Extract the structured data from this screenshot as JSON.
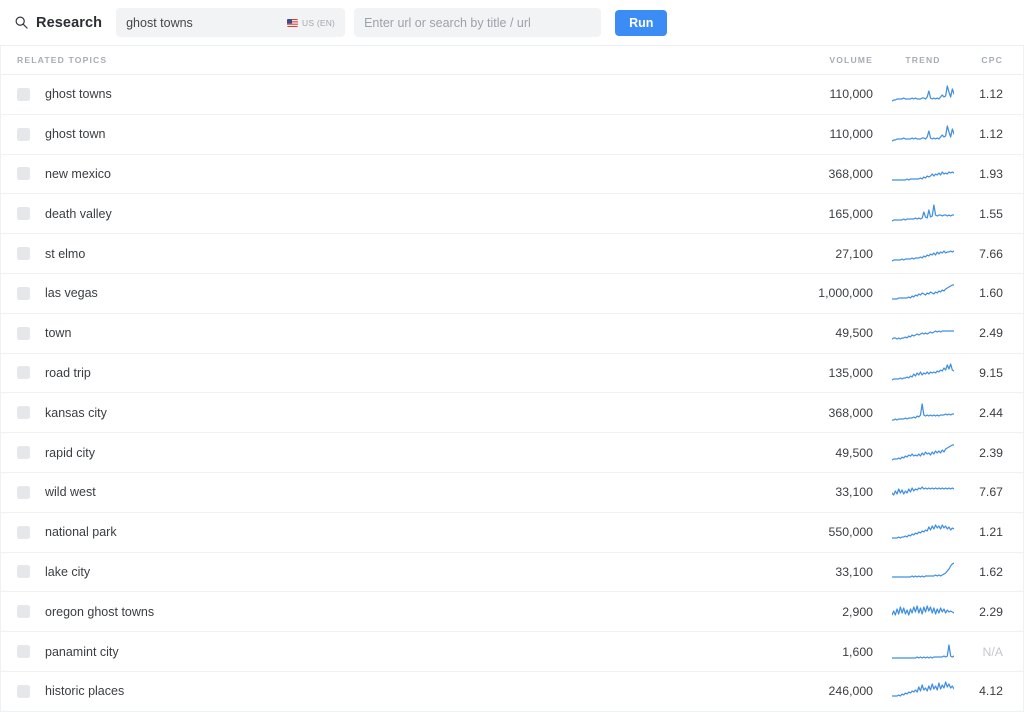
{
  "app": {
    "brand_label": "Research",
    "brand_icon": "search-icon"
  },
  "search": {
    "keyword_value": "ghost towns",
    "keyword_placeholder": "ghost towns",
    "locale_label": "US (EN)",
    "locale_flag_icon": "us-flag-icon",
    "url_value": "",
    "url_placeholder": "Enter url or search by title / url",
    "run_label": "Run"
  },
  "table": {
    "columns": {
      "topic": "RELATED TOPICS",
      "volume": "VOLUME",
      "trend": "TREND",
      "cpc": "CPC"
    },
    "rows": [
      {
        "topic": "ghost towns",
        "volume": "110,000",
        "cpc": "1.12",
        "trend": [
          18,
          17,
          17,
          16,
          16,
          16,
          16,
          15,
          16,
          16,
          16,
          16,
          15,
          16,
          15,
          16,
          16,
          16,
          15,
          15,
          16,
          14,
          8,
          15,
          16,
          15,
          16,
          15,
          16,
          14,
          12,
          14,
          13,
          3,
          9,
          14,
          6,
          11
        ]
      },
      {
        "topic": "ghost town",
        "volume": "110,000",
        "cpc": "1.12",
        "trend": [
          18,
          17,
          17,
          16,
          16,
          16,
          16,
          15,
          16,
          16,
          16,
          16,
          15,
          16,
          15,
          16,
          16,
          16,
          15,
          15,
          16,
          14,
          8,
          15,
          16,
          15,
          16,
          15,
          16,
          14,
          12,
          14,
          13,
          3,
          9,
          14,
          6,
          11
        ]
      },
      {
        "topic": "new mexico",
        "volume": "368,000",
        "cpc": "1.93",
        "trend": [
          17,
          17,
          17,
          17,
          17,
          17,
          17,
          17,
          17,
          16,
          17,
          16,
          16,
          16,
          16,
          16,
          16,
          15,
          16,
          14,
          15,
          13,
          14,
          13,
          11,
          13,
          11,
          12,
          10,
          12,
          9,
          11,
          10,
          11,
          9,
          10,
          9,
          10
        ]
      },
      {
        "topic": "death valley",
        "volume": "165,000",
        "cpc": "1.55",
        "trend": [
          18,
          17,
          17,
          17,
          17,
          17,
          17,
          16,
          17,
          16,
          16,
          16,
          16,
          16,
          15,
          16,
          15,
          16,
          15,
          9,
          14,
          15,
          7,
          14,
          13,
          2,
          12,
          13,
          12,
          12,
          13,
          12,
          12,
          13,
          12,
          13,
          12,
          12
        ]
      },
      {
        "topic": "st elmo",
        "volume": "27,100",
        "cpc": "7.66",
        "trend": [
          18,
          17,
          17,
          17,
          17,
          17,
          16,
          17,
          16,
          16,
          16,
          16,
          15,
          16,
          15,
          15,
          15,
          14,
          15,
          13,
          14,
          12,
          13,
          11,
          12,
          10,
          12,
          9,
          11,
          9,
          10,
          8,
          10,
          9,
          9,
          8,
          9,
          8
        ]
      },
      {
        "topic": "las vegas",
        "volume": "1,000,000",
        "cpc": "1.60",
        "trend": [
          17,
          17,
          17,
          17,
          16,
          16,
          16,
          16,
          16,
          16,
          15,
          16,
          14,
          15,
          13,
          14,
          12,
          13,
          11,
          12,
          13,
          11,
          12,
          10,
          11,
          12,
          10,
          11,
          9,
          10,
          8,
          9,
          7,
          6,
          5,
          4,
          3,
          3
        ]
      },
      {
        "topic": "town",
        "volume": "49,500",
        "cpc": "2.49",
        "trend": [
          17,
          16,
          16,
          17,
          16,
          17,
          16,
          16,
          15,
          16,
          14,
          15,
          13,
          14,
          13,
          12,
          13,
          12,
          11,
          12,
          11,
          12,
          11,
          10,
          11,
          10,
          9,
          10,
          9,
          10,
          9,
          9,
          9,
          9,
          9,
          9,
          9,
          9
        ]
      },
      {
        "topic": "road trip",
        "volume": "135,000",
        "cpc": "9.15",
        "trend": [
          18,
          17,
          17,
          17,
          17,
          16,
          17,
          16,
          16,
          15,
          16,
          14,
          15,
          12,
          14,
          11,
          13,
          10,
          13,
          11,
          12,
          10,
          12,
          10,
          11,
          10,
          11,
          9,
          10,
          8,
          9,
          6,
          8,
          3,
          7,
          2,
          8,
          9
        ]
      },
      {
        "topic": "kansas city",
        "volume": "368,000",
        "cpc": "2.44",
        "trend": [
          18,
          18,
          17,
          18,
          17,
          17,
          17,
          17,
          16,
          17,
          16,
          16,
          16,
          15,
          16,
          14,
          15,
          13,
          2,
          13,
          14,
          13,
          14,
          13,
          14,
          13,
          14,
          13,
          14,
          13,
          13,
          13,
          12,
          13,
          12,
          13,
          12,
          12
        ]
      },
      {
        "topic": "rapid city",
        "volume": "49,500",
        "cpc": "2.39",
        "trend": [
          18,
          17,
          17,
          17,
          16,
          17,
          15,
          16,
          14,
          15,
          13,
          14,
          12,
          14,
          13,
          14,
          12,
          14,
          11,
          13,
          10,
          12,
          11,
          13,
          10,
          12,
          9,
          11,
          9,
          11,
          8,
          10,
          7,
          6,
          5,
          4,
          3,
          3
        ]
      },
      {
        "topic": "wild west",
        "volume": "33,100",
        "cpc": "7.67",
        "trend": [
          12,
          14,
          10,
          13,
          8,
          12,
          9,
          13,
          10,
          12,
          8,
          11,
          7,
          10,
          8,
          9,
          7,
          8,
          6,
          8,
          7,
          8,
          7,
          8,
          7,
          8,
          7,
          8,
          7,
          8,
          7,
          8,
          7,
          8,
          7,
          8,
          7,
          8
        ]
      },
      {
        "topic": "national park",
        "volume": "550,000",
        "cpc": "1.21",
        "trend": [
          17,
          17,
          17,
          17,
          16,
          17,
          16,
          16,
          15,
          16,
          14,
          15,
          13,
          14,
          12,
          13,
          11,
          12,
          10,
          11,
          9,
          10,
          6,
          9,
          5,
          8,
          4,
          7,
          5,
          8,
          4,
          7,
          5,
          8,
          6,
          9,
          7,
          8
        ]
      },
      {
        "topic": "lake city",
        "volume": "33,100",
        "cpc": "1.62",
        "trend": [
          16,
          16,
          16,
          16,
          16,
          16,
          16,
          16,
          16,
          16,
          16,
          16,
          15,
          16,
          15,
          16,
          15,
          16,
          15,
          16,
          15,
          15,
          15,
          15,
          15,
          15,
          14,
          15,
          14,
          15,
          14,
          13,
          12,
          10,
          8,
          5,
          3,
          2
        ]
      },
      {
        "topic": "oregon ghost towns",
        "volume": "2,900",
        "cpc": "2.29",
        "trend": [
          14,
          10,
          14,
          8,
          13,
          6,
          12,
          7,
          13,
          9,
          14,
          8,
          12,
          6,
          11,
          5,
          12,
          7,
          13,
          6,
          11,
          5,
          10,
          6,
          12,
          7,
          13,
          8,
          12,
          7,
          11,
          8,
          12,
          9,
          11,
          10,
          11,
          12
        ]
      },
      {
        "topic": "panamint city",
        "volume": "1,600",
        "cpc": "N/A",
        "trend": [
          17,
          17,
          17,
          17,
          17,
          17,
          17,
          17,
          17,
          17,
          17,
          17,
          17,
          17,
          17,
          16,
          17,
          16,
          17,
          16,
          17,
          16,
          17,
          16,
          17,
          16,
          16,
          16,
          16,
          16,
          16,
          15,
          16,
          15,
          4,
          15,
          16,
          15
        ]
      },
      {
        "topic": "historic places",
        "volume": "246,000",
        "cpc": "4.12",
        "trend": [
          16,
          16,
          16,
          16,
          15,
          16,
          14,
          15,
          13,
          14,
          12,
          13,
          11,
          12,
          10,
          12,
          7,
          11,
          5,
          10,
          8,
          11,
          6,
          10,
          4,
          9,
          6,
          10,
          3,
          9,
          5,
          8,
          2,
          7,
          4,
          8,
          6,
          9
        ]
      }
    ]
  },
  "colors": {
    "accent": "#3b8cf4",
    "spark_line": "#3f8fe0",
    "text": "#3a3d42",
    "muted": "#a7acb4",
    "field_bg": "#f2f3f5",
    "border": "#f0f1f3"
  }
}
